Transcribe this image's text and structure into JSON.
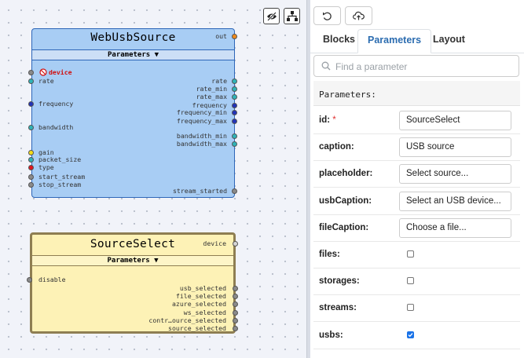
{
  "canvas": {
    "toolbar": {
      "hide_icon": "eye-slash-icon",
      "layout_icon": "hierarchy-icon"
    },
    "nodes": [
      {
        "title": "WebUsbSource",
        "params_label": "Parameters ▼",
        "color": "#a8cdf4",
        "inputs": [
          {
            "label": "device",
            "port": "gray",
            "status": "error"
          },
          {
            "label": "rate",
            "port": "cyan"
          },
          {
            "label": "frequency",
            "port": "blue"
          },
          {
            "label": "bandwidth",
            "port": "cyan"
          },
          {
            "label": "gain",
            "port": "yellow"
          },
          {
            "label": "packet_size",
            "port": "cyan"
          },
          {
            "label": "type",
            "port": "red"
          },
          {
            "label": "start_stream",
            "port": "gray"
          },
          {
            "label": "stop_stream",
            "port": "gray"
          }
        ],
        "outputs": [
          {
            "label": "out",
            "port": "orange"
          },
          {
            "label": "rate",
            "port": "cyan"
          },
          {
            "label": "rate_min",
            "port": "cyan"
          },
          {
            "label": "rate_max",
            "port": "cyan"
          },
          {
            "label": "frequency",
            "port": "blue"
          },
          {
            "label": "frequency_min",
            "port": "blue"
          },
          {
            "label": "frequency_max",
            "port": "blue"
          },
          {
            "label": "bandwidth_min",
            "port": "cyan"
          },
          {
            "label": "bandwidth_max",
            "port": "cyan"
          },
          {
            "label": "stream_started",
            "port": "gray"
          }
        ]
      },
      {
        "title": "SourceSelect",
        "params_label": "Parameters ▼",
        "color": "#fdf2b6",
        "inputs": [
          {
            "label": "disable",
            "port": "gray"
          }
        ],
        "outputs": [
          {
            "label": "device",
            "port": "light"
          },
          {
            "label": "usb_selected",
            "port": "gray"
          },
          {
            "label": "file_selected",
            "port": "gray"
          },
          {
            "label": "azure_selected",
            "port": "gray"
          },
          {
            "label": "ws_selected",
            "port": "gray"
          },
          {
            "label": "contr…ource_selected",
            "port": "gray"
          },
          {
            "label": "source_selected",
            "port": "gray"
          }
        ]
      }
    ]
  },
  "panel": {
    "undo_icon": "undo-icon",
    "upload_icon": "cloud-upload-icon",
    "tabs": [
      {
        "label": "Blocks",
        "active": false
      },
      {
        "label": "Parameters",
        "active": true
      },
      {
        "label": "Layout",
        "active": false
      }
    ],
    "search_placeholder": "Find a parameter",
    "params_header": "Parameters:",
    "fields": [
      {
        "label": "id:",
        "required": "*",
        "type": "text",
        "value": "SourceSelect"
      },
      {
        "label": "caption:",
        "type": "text",
        "value": "USB source"
      },
      {
        "label": "placeholder:",
        "type": "text",
        "value": "Select source..."
      },
      {
        "label": "usbCaption:",
        "type": "text",
        "value": "Select an USB device..."
      },
      {
        "label": "fileCaption:",
        "type": "text",
        "value": "Choose a file..."
      },
      {
        "label": "files:",
        "type": "checkbox",
        "checked": false
      },
      {
        "label": "storages:",
        "type": "checkbox",
        "checked": false
      },
      {
        "label": "streams:",
        "type": "checkbox",
        "checked": false
      },
      {
        "label": "usbs:",
        "type": "checkbox",
        "checked": true
      }
    ]
  },
  "colors": {
    "accent": "#2b6cb0",
    "checkbox_checked": "#1a73e8",
    "required": "#e03131"
  }
}
